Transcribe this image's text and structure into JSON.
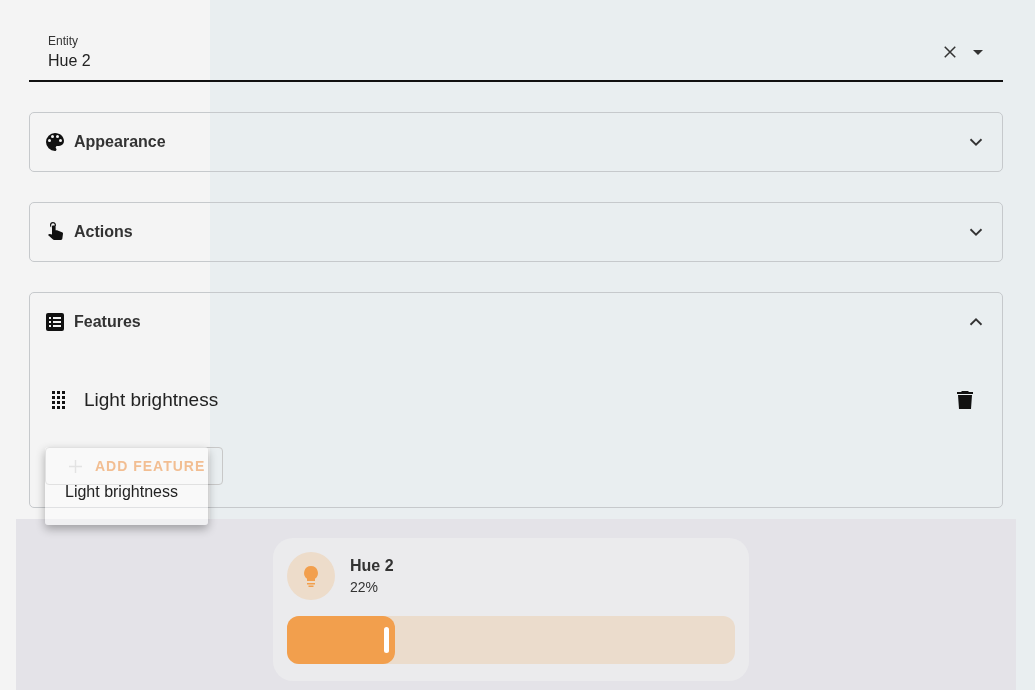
{
  "entity_field": {
    "label": "Entity",
    "value": "Hue 2"
  },
  "sections": [
    {
      "kind": "appearance",
      "title": "Appearance",
      "expanded": false
    },
    {
      "kind": "actions",
      "title": "Actions",
      "expanded": false
    },
    {
      "kind": "features",
      "title": "Features",
      "expanded": true,
      "features": [
        {
          "name": "Light brightness"
        }
      ],
      "add_button": "ADD FEATURE"
    }
  ],
  "drag_ghost": {
    "label": "Light brightness"
  },
  "preview": {
    "name": "Hue 2",
    "state": "22%",
    "level": 0.24
  }
}
